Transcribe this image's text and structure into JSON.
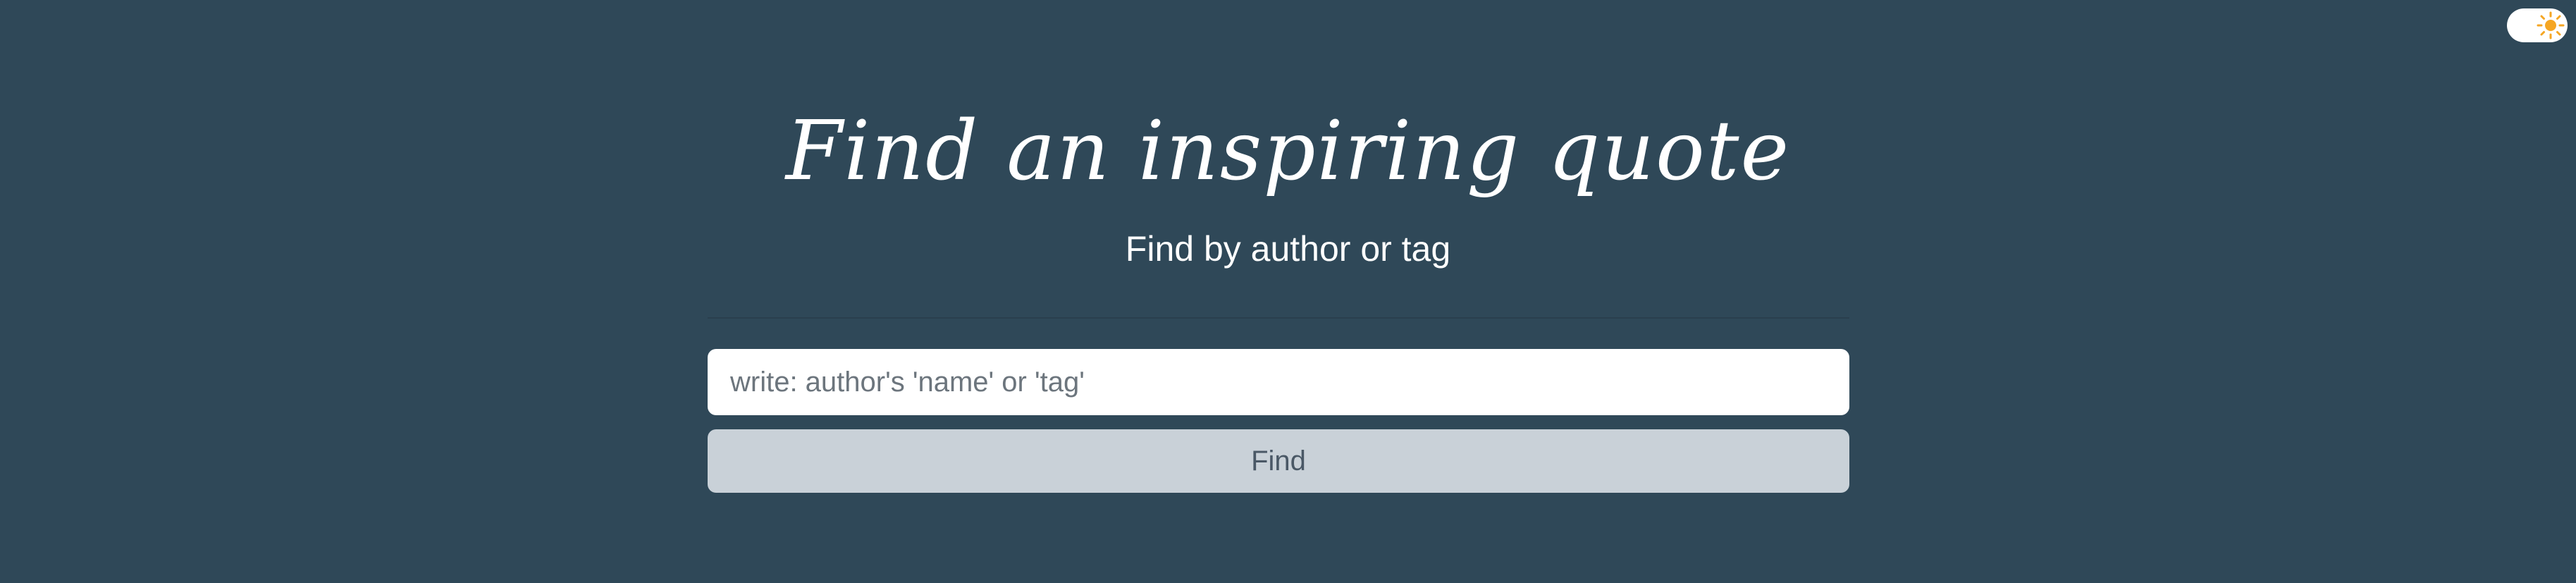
{
  "header": {
    "title": "Find an inspiring quote",
    "subtitle": "Find by author or tag"
  },
  "theme_toggle": {
    "icon": "sun-icon",
    "sun_color": "#f5a623"
  },
  "search": {
    "placeholder": "write: author's 'name' or 'tag'",
    "value": "",
    "button_label": "Find"
  },
  "colors": {
    "background": "#2f4858",
    "button_bg": "#c9d1d8",
    "text": "#ffffff"
  }
}
